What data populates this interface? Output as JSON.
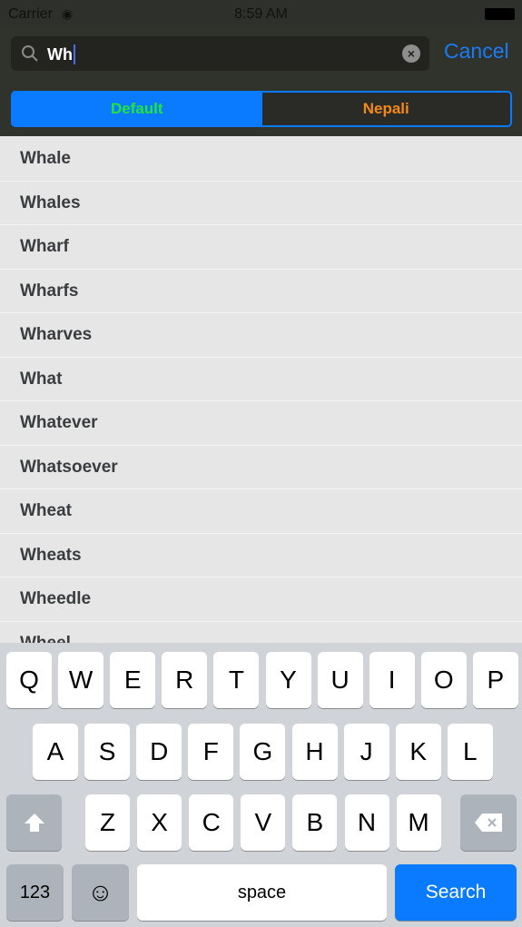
{
  "status": {
    "carrier": "Carrier",
    "time": "8:59 AM"
  },
  "search": {
    "value": "Wh",
    "cancel_label": "Cancel"
  },
  "segments": [
    "Default",
    "Nepali"
  ],
  "colors": {
    "accent": "#0a7bff",
    "default_text": "#22e53a",
    "nepali_text": "#f48a14"
  },
  "results": [
    "Whale",
    "Whales",
    "Wharf",
    "Wharfs",
    "Wharves",
    "What",
    "Whatever",
    "Whatsoever",
    "Wheat",
    "Wheats",
    "Wheedle",
    "Wheel"
  ],
  "keyboard": {
    "row1": [
      "Q",
      "W",
      "E",
      "R",
      "T",
      "Y",
      "U",
      "I",
      "O",
      "P"
    ],
    "row2": [
      "A",
      "S",
      "D",
      "F",
      "G",
      "H",
      "J",
      "K",
      "L"
    ],
    "row3": [
      "Z",
      "X",
      "C",
      "V",
      "B",
      "N",
      "M"
    ],
    "numbers": "123",
    "space": "space",
    "search": "Search"
  }
}
